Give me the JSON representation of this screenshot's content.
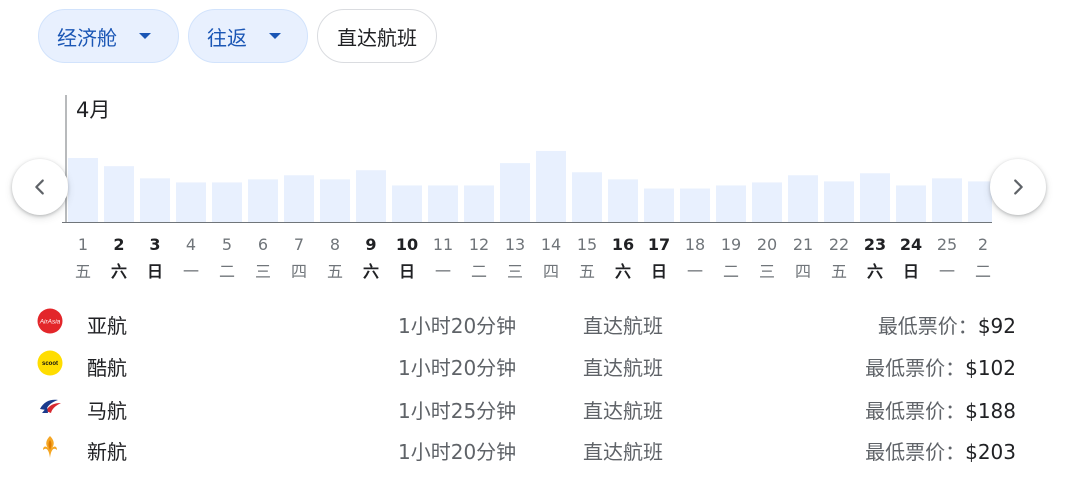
{
  "filters": {
    "cabin": "经济舱",
    "trip_type": "往返",
    "nonstop": "直达航班"
  },
  "chart_data": {
    "type": "bar",
    "title": "4月",
    "categories": [
      "1",
      "1",
      "2",
      "3",
      "4",
      "5",
      "6",
      "7",
      "8",
      "9",
      "10",
      "11",
      "12",
      "13",
      "14",
      "15",
      "16",
      "17",
      "18",
      "19",
      "20",
      "21",
      "22",
      "23",
      "24",
      "25",
      "2"
    ],
    "weekdays": [
      "日",
      "五",
      "六",
      "日",
      "一",
      "二",
      "三",
      "四",
      "五",
      "六",
      "日",
      "一",
      "二",
      "三",
      "四",
      "五",
      "六",
      "日",
      "一",
      "二",
      "三",
      "四",
      "五",
      "六",
      "日",
      "一",
      "二"
    ],
    "bold": [
      false,
      false,
      true,
      true,
      false,
      false,
      false,
      false,
      false,
      true,
      true,
      false,
      false,
      false,
      false,
      false,
      true,
      true,
      false,
      false,
      false,
      false,
      false,
      true,
      true,
      false,
      false
    ],
    "values": [
      40,
      63,
      55,
      43,
      39,
      39,
      42,
      46,
      42,
      51,
      36,
      36,
      36,
      58,
      70,
      49,
      42,
      33,
      33,
      36,
      39,
      46,
      40,
      48,
      36,
      43,
      40
    ],
    "ylim": [
      0,
      130
    ],
    "bar_color": "#e8f0fe",
    "axis_color": "#70757a"
  },
  "airlines": [
    {
      "name": "亚航",
      "logo": "airasia-logo",
      "duration": "1小时20分钟",
      "stops": "直达航班",
      "price_label": "最低票价：",
      "price": "$92"
    },
    {
      "name": "酷航",
      "logo": "scoot-logo",
      "duration": "1小时20分钟",
      "stops": "直达航班",
      "price_label": "最低票价：",
      "price": "$102"
    },
    {
      "name": "马航",
      "logo": "malaysia-airlines-logo",
      "duration": "1小时25分钟",
      "stops": "直达航班",
      "price_label": "最低票价：",
      "price": "$188"
    },
    {
      "name": "新航",
      "logo": "singapore-airlines-logo",
      "duration": "1小时20分钟",
      "stops": "直达航班",
      "price_label": "最低票价：",
      "price": "$203"
    }
  ],
  "logo_text": {
    "airasia": "AirAsia",
    "scoot": "scoot"
  },
  "icons": {
    "prev": "chevron-left-icon",
    "next": "chevron-right-icon",
    "dropdown": "caret-down-icon"
  }
}
